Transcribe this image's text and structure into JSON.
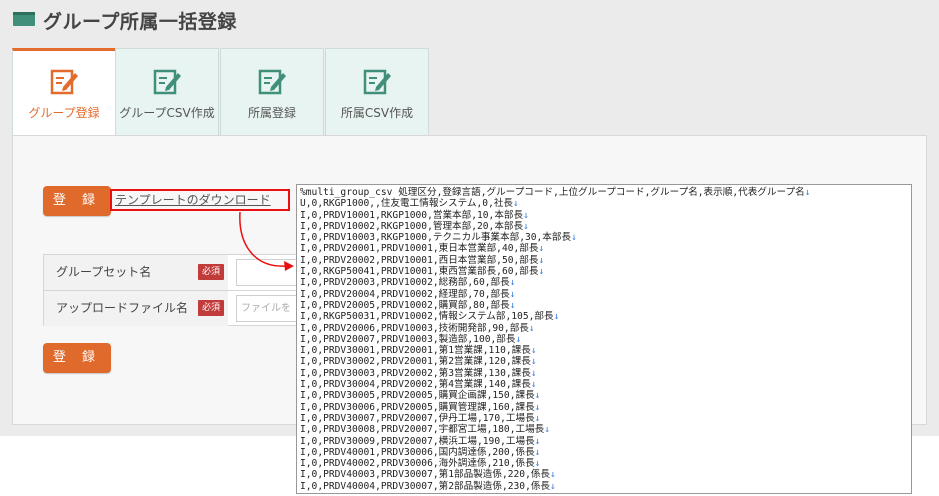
{
  "header": {
    "title": "グループ所属一括登録",
    "icon": "window-icon"
  },
  "tabs": [
    {
      "label": "グループ登録",
      "icon": "edit-icon",
      "active": true
    },
    {
      "label": "グループCSV作成",
      "icon": "edit-icon",
      "active": false
    },
    {
      "label": "所属登録",
      "icon": "edit-icon",
      "active": false
    },
    {
      "label": "所属CSV作成",
      "icon": "edit-icon",
      "active": false
    }
  ],
  "buttons": {
    "register_top": "登 録",
    "register_bottom": "登 録"
  },
  "template_link": "テンプレートのダウンロード",
  "form": {
    "group_set_label": "グループセット名",
    "upload_label": "アップロードファイル名",
    "required_badge": "必須",
    "file_placeholder": "ファイルを"
  },
  "csv_lines": [
    "%multi_group_csv 処理区分,登録言語,グループコード,上位グループコード,グループ名,表示順,代表グループ名",
    "U,0,RKGP1000,,住友電工情報システム,0,社長",
    "I,0,PRDV10001,RKGP1000,営業本部,10,本部長",
    "I,0,PRDV10002,RKGP1000,管理本部,20,本部長",
    "I,0,PRDV10003,RKGP1000,テクニカル事業本部,30,本部長",
    "I,0,PRDV20001,PRDV10001,東日本営業部,40,部長",
    "I,0,PRDV20002,PRDV10001,西日本営業部,50,部長",
    "I,0,RKGP50041,PRDV10001,東西営業部長,60,部長",
    "I,0,PRDV20003,PRDV10002,総務部,60,部長",
    "I,0,PRDV20004,PRDV10002,経理部,70,部長",
    "I,0,PRDV20005,PRDV10002,購買部,80,部長",
    "I,0,RKGP50031,PRDV10002,情報システム部,105,部長",
    "I,0,PRDV20006,PRDV10003,技術開発部,90,部長",
    "I,0,PRDV20007,PRDV10003,製造部,100,部長",
    "I,0,PRDV30001,PRDV20001,第1営業課,110,課長",
    "I,0,PRDV30002,PRDV20001,第2営業課,120,課長",
    "I,0,PRDV30003,PRDV20002,第3営業課,130,課長",
    "I,0,PRDV30004,PRDV20002,第4営業課,140,課長",
    "I,0,PRDV30005,PRDV20005,購買企画課,150,課長",
    "I,0,PRDV30006,PRDV20005,購買管理課,160,課長",
    "I,0,PRDV30007,PRDV20007,伊丹工場,170,工場長",
    "I,0,PRDV30008,PRDV20007,宇都宮工場,180,工場長",
    "I,0,PRDV30009,PRDV20007,横浜工場,190,工場長",
    "I,0,PRDV40001,PRDV30006,国内調達係,200,係長",
    "I,0,PRDV40002,PRDV30006,海外調達係,210,係長",
    "I,0,PRDV40003,PRDV30007,第1部品製造係,220,係長",
    "I,0,PRDV40004,PRDV30007,第2部品製造係,230,係長"
  ],
  "line_end_mark": "↓",
  "colors": {
    "accent": "#e06a2c",
    "link_highlight": "#e81010",
    "tab_bg": "#e8f4f1",
    "icon": "#3f8f7b"
  }
}
